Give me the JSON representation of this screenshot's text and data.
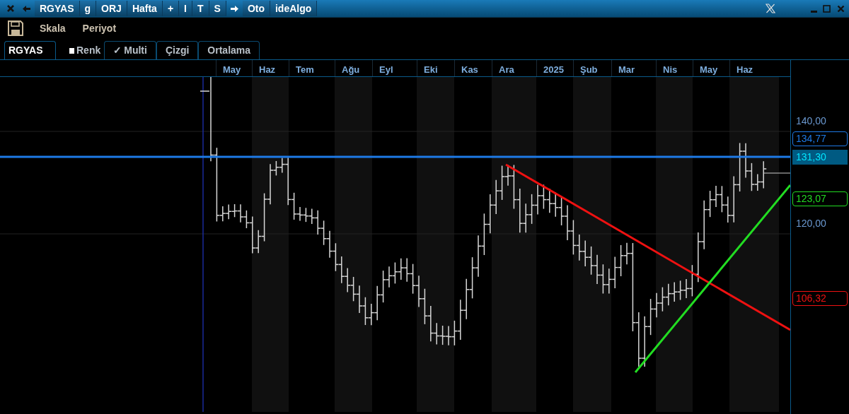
{
  "title_bar": {
    "items": [
      {
        "kind": "close"
      },
      {
        "kind": "back"
      },
      {
        "kind": "text",
        "label": "RGYAS"
      },
      {
        "kind": "text",
        "label": "g"
      },
      {
        "kind": "text",
        "label": "ORJ"
      },
      {
        "kind": "text",
        "label": "Hafta"
      },
      {
        "kind": "text",
        "label": "+"
      },
      {
        "kind": "text",
        "label": "I"
      },
      {
        "kind": "text",
        "label": "T"
      },
      {
        "kind": "text",
        "label": "S"
      },
      {
        "kind": "forward"
      },
      {
        "kind": "text",
        "label": "Oto"
      },
      {
        "kind": "text",
        "label": "ideAlgo"
      }
    ]
  },
  "toolbar": {
    "menus": [
      "Skala",
      "Periyot"
    ]
  },
  "tabs": [
    {
      "label": "RGYAS",
      "selected": true,
      "kind": "plain"
    },
    {
      "label": "Renk",
      "selected": false,
      "kind": "square"
    },
    {
      "label": "Multi",
      "selected": false,
      "kind": "check",
      "mark": "✓"
    },
    {
      "label": "Çizgi",
      "selected": false,
      "kind": "plain"
    },
    {
      "label": "Ortalama",
      "selected": false,
      "kind": "plain"
    }
  ],
  "chart": {
    "months": [
      "May",
      "Haz",
      "Tem",
      "Ağu",
      "Eyl",
      "Eki",
      "Kas",
      "Ara",
      "2025",
      "Şub",
      "Mar",
      "Nis",
      "May",
      "Haz"
    ],
    "y_ticks": [
      "140,00",
      "120,00"
    ],
    "price_tags": [
      {
        "label": "134,77",
        "kind": "outline",
        "color": "#1e7ae6"
      },
      {
        "label": "131,30",
        "kind": "filled",
        "color": "#005a82"
      },
      {
        "label": "123,07",
        "kind": "outline",
        "color": "#22dd22"
      },
      {
        "label": "106,32",
        "kind": "outline",
        "color": "#ee1111"
      }
    ]
  }
}
